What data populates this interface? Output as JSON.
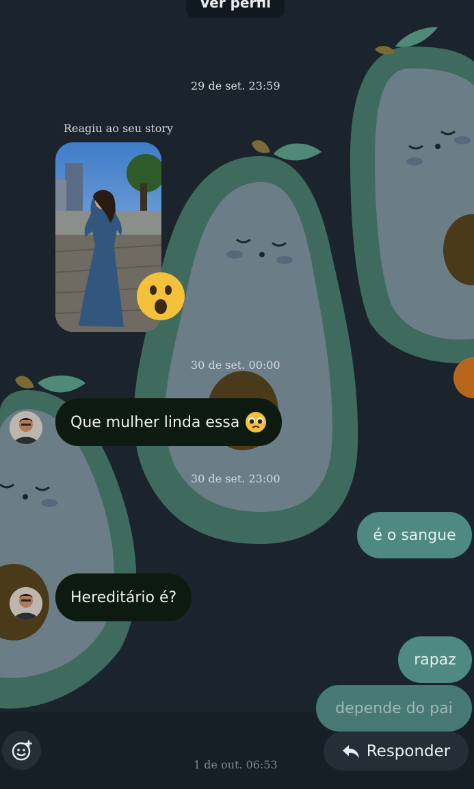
{
  "top_button": {
    "label": "Ver perfil"
  },
  "timestamps": [
    "29 de set. 23:59",
    "30 de set. 00:00",
    "30 de set. 23:00",
    "1 de out. 06:53"
  ],
  "story_reaction": {
    "label": "Reagiu ao seu story",
    "reaction_icon": "astonished-emoji"
  },
  "messages": {
    "incoming": [
      {
        "text": "Que mulher linda essa",
        "emoji": "pleading-face"
      },
      {
        "text": "Hereditário é?"
      }
    ],
    "outgoing": [
      {
        "text": "é o sangue"
      },
      {
        "text": "rapaz"
      },
      {
        "text": "depende do pai"
      }
    ]
  },
  "bottom_bar": {
    "sticker_icon": "sticker-add-icon",
    "reply_label": "Responder",
    "reply_icon": "reply-arrow-icon"
  },
  "colors": {
    "background": "#1b242d",
    "avocado_outer": "#3f6a5e",
    "avocado_inner": "#6b7e87",
    "outgoing_bubble": "#4f8a82",
    "incoming_bubble": "#0d1a0f"
  }
}
